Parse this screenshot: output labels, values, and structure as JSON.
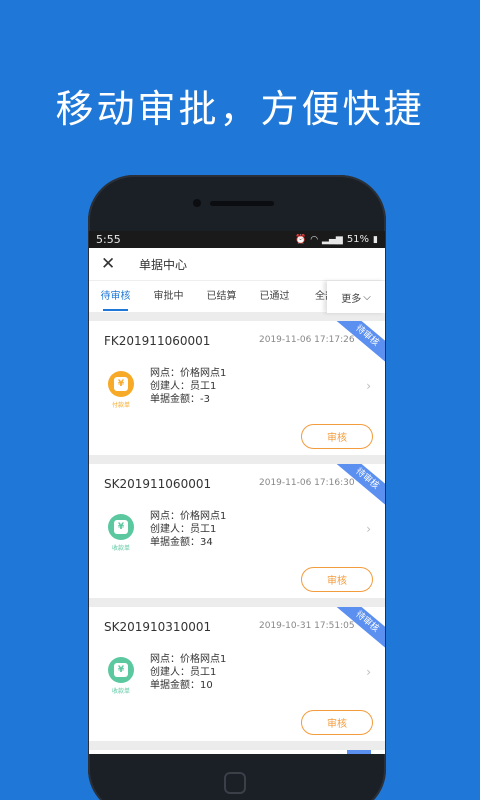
{
  "headline": "移动审批，方便快捷",
  "status": {
    "time": "5:55",
    "battery": "51%",
    "wifi_icon": "wifi-icon",
    "signal_icon": "signal-icon",
    "alarm_icon": "alarm-icon"
  },
  "topbar": {
    "close_icon": "close-icon",
    "title": "单据中心"
  },
  "tabs": [
    "待审核",
    "审批中",
    "已结算",
    "已通过",
    "全部"
  ],
  "more_label": "更多",
  "colors": {
    "brand": "#1f78d8",
    "ribbon": "#5b8ff0",
    "approve": "#f39c3d",
    "pay_icon": "#f7a928",
    "receive_icon": "#5bc8a0"
  },
  "cards": [
    {
      "no": "FK201911060001",
      "time": "2019-11-06 17:17:26",
      "ribbon": "待审核",
      "icon_type": "payment",
      "icon_label": "付款单",
      "outlet": "网点：价格网点1",
      "creator": "创建人：员工1",
      "amount": "单据金额：-3",
      "action": "审核"
    },
    {
      "no": "SK201911060001",
      "time": "2019-11-06 17:16:30",
      "ribbon": "待审核",
      "icon_type": "receipt",
      "icon_label": "收款单",
      "outlet": "网点：价格网点1",
      "creator": "创建人：员工1",
      "amount": "单据金额：34",
      "action": "审核"
    },
    {
      "no": "SK201910310001",
      "time": "2019-10-31 17:51:05",
      "ribbon": "待审核",
      "icon_type": "receipt",
      "icon_label": "收款单",
      "outlet": "网点：价格网点1",
      "creator": "创建人：员工1",
      "amount": "单据金额：10",
      "action": "审核"
    }
  ]
}
